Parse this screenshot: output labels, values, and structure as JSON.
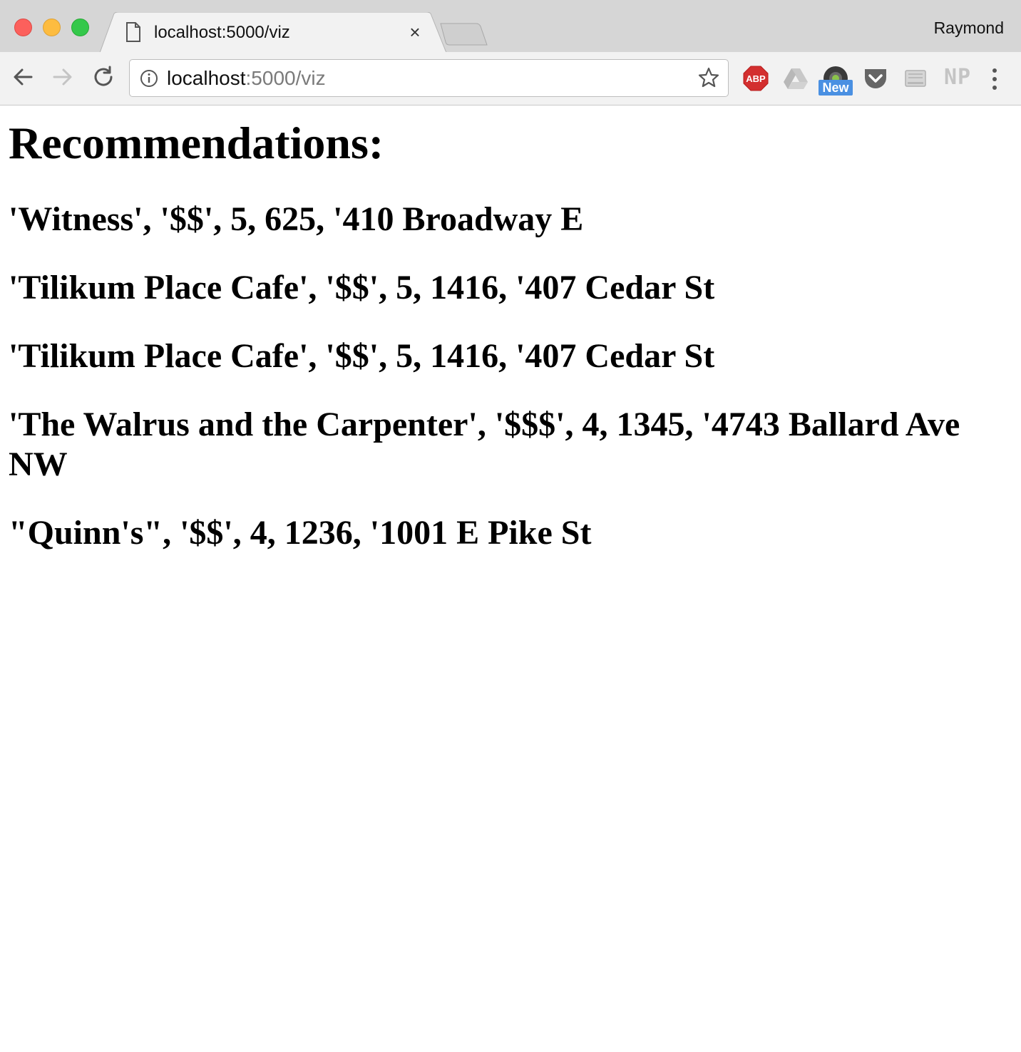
{
  "browser": {
    "tab_title": "localhost:5000/viz",
    "profile_name": "Raymond",
    "url_host": "localhost",
    "url_rest": ":5000/viz",
    "new_badge": "New",
    "np_label": "NP",
    "abp_label": "ABP",
    "close_glyph": "×"
  },
  "page": {
    "heading": "Recommendations:",
    "recommendations": [
      "'Witness', '$$', 5, 625, '410 Broadway E",
      "'Tilikum Place Cafe', '$$', 5, 1416, '407 Cedar St",
      "'Tilikum Place Cafe', '$$', 5, 1416, '407 Cedar St",
      "'The Walrus and the Carpenter', '$$$', 4, 1345, '4743 Ballard Ave NW",
      "\"Quinn's\", '$$', 4, 1236, '1001 E Pike St"
    ]
  }
}
